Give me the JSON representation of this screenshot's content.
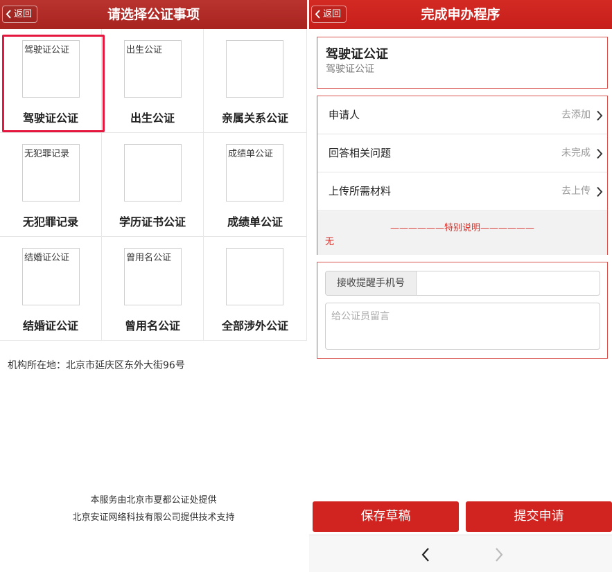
{
  "left": {
    "back_label": "返回",
    "title": "请选择公证事项",
    "items": [
      {
        "label": "驾驶证公证",
        "thumb_text": "驾驶证公证"
      },
      {
        "label": "出生公证",
        "thumb_text": "出生公证"
      },
      {
        "label": "亲属关系公证",
        "thumb_text": ""
      },
      {
        "label": "无犯罪记录",
        "thumb_text": "无犯罪记录"
      },
      {
        "label": "学历证书公证",
        "thumb_text": ""
      },
      {
        "label": "成绩单公证",
        "thumb_text": "成绩单公证"
      },
      {
        "label": "结婚证公证",
        "thumb_text": "结婚证公证"
      },
      {
        "label": "曾用名公证",
        "thumb_text": "曾用名公证"
      },
      {
        "label": "全部涉外公证",
        "thumb_text": ""
      }
    ],
    "address": "机构所在地：北京市延庆区东外大街96号",
    "footer_line1": "本服务由北京市夏都公证处提供",
    "footer_line2": "北京安证网络科技有限公司提供技术支持"
  },
  "right": {
    "back_label": "返回",
    "title": "完成申办程序",
    "item_title": "驾驶证公证",
    "item_subtitle": "驾驶证公证",
    "steps": [
      {
        "label": "申请人",
        "status": "去添加"
      },
      {
        "label": "回答相关问题",
        "status": "未完成"
      },
      {
        "label": "上传所需材料",
        "status": "去上传"
      }
    ],
    "notice_header": "——————特别说明——————",
    "notice_body": "无",
    "phone_label": "接收提醒手机号",
    "phone_value": "",
    "message_placeholder": "给公证员留言",
    "save_label": "保存草稿",
    "submit_label": "提交申请"
  },
  "icons": {
    "back": "chevron-left-icon",
    "row_arrow": "chevron-right-icon",
    "nav_back": "chevron-left-icon",
    "nav_forward": "chevron-right-icon"
  },
  "colors": {
    "left_header": "#b12c28",
    "right_header": "#cd2520",
    "accent": "#d12420",
    "selection": "#e5173f",
    "notice_text": "#d9302a"
  }
}
